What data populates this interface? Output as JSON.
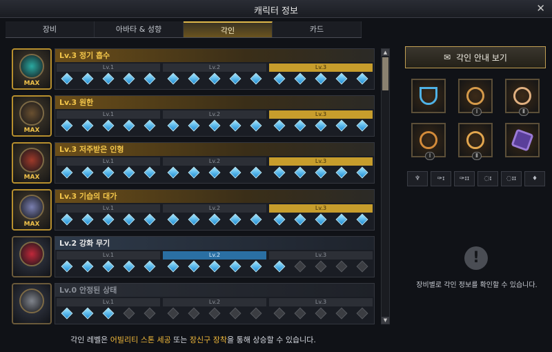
{
  "window": {
    "title": "캐릭터 정보",
    "close_icon": "close-icon"
  },
  "tabs": [
    {
      "label": "장비",
      "active": false
    },
    {
      "label": "아바타 & 성향",
      "active": false
    },
    {
      "label": "각인",
      "active": true
    },
    {
      "label": "카드",
      "active": false
    }
  ],
  "engravings": [
    {
      "name": "Lv.3 정기 흡수",
      "level": 3,
      "max": true,
      "max_label": "MAX",
      "levels": [
        "Lv.1",
        "Lv.2",
        "Lv.3"
      ],
      "gems_on": 15
    },
    {
      "name": "Lv.3 원한",
      "level": 3,
      "max": true,
      "max_label": "MAX",
      "levels": [
        "Lv.1",
        "Lv.2",
        "Lv.3"
      ],
      "gems_on": 15
    },
    {
      "name": "Lv.3 저주받은 인형",
      "level": 3,
      "max": true,
      "max_label": "MAX",
      "levels": [
        "Lv.1",
        "Lv.2",
        "Lv.3"
      ],
      "gems_on": 15
    },
    {
      "name": "Lv.3 기습의 대가",
      "level": 3,
      "max": true,
      "max_label": "MAX",
      "levels": [
        "Lv.1",
        "Lv.2",
        "Lv.3"
      ],
      "gems_on": 15
    },
    {
      "name": "Lv.2 강화 무기",
      "level": 2,
      "max": false,
      "max_label": "",
      "levels": [
        "Lv.1",
        "Lv.2",
        "Lv.3"
      ],
      "gems_on": 11
    },
    {
      "name": "Lv.0 안정된 상태",
      "level": 0,
      "max": false,
      "max_label": "",
      "levels": [
        "Lv.1",
        "Lv.2",
        "Lv.3"
      ],
      "gems_on": 3
    }
  ],
  "guide_button": {
    "label": "각인 안내 보기",
    "icon": "book-icon"
  },
  "equipment_slots": [
    {
      "name": "necklace",
      "roman": ""
    },
    {
      "name": "earring-1",
      "roman": "Ⅰ"
    },
    {
      "name": "earring-2",
      "roman": "Ⅱ"
    },
    {
      "name": "ring-1",
      "roman": "Ⅰ"
    },
    {
      "name": "ring-2",
      "roman": "Ⅱ"
    },
    {
      "name": "ability-stone",
      "roman": ""
    }
  ],
  "filters": [
    "necklace-filter",
    "earring-1-filter",
    "earring-2-filter",
    "ring-1-filter",
    "ring-2-filter",
    "stone-filter"
  ],
  "filter_glyphs": [
    "♆",
    "✑ɪ",
    "✑ɪɪ",
    "◌ɪ",
    "◌ɪɪ",
    "♦"
  ],
  "info": {
    "icon": "!",
    "text": "장비별로 각인 정보를 확인할 수 있습니다."
  },
  "footer": {
    "pre": "각인 레벨은 ",
    "hl1": "어빌리티 스톤 세공",
    "mid": " 또는 ",
    "hl2": "장신구 장착",
    "post": "을 통해 상승할 수 있습니다."
  },
  "colors": {
    "gold": "#c79d2c",
    "gem_blue": "#1f8dd6",
    "accent": "#e0b84a"
  }
}
